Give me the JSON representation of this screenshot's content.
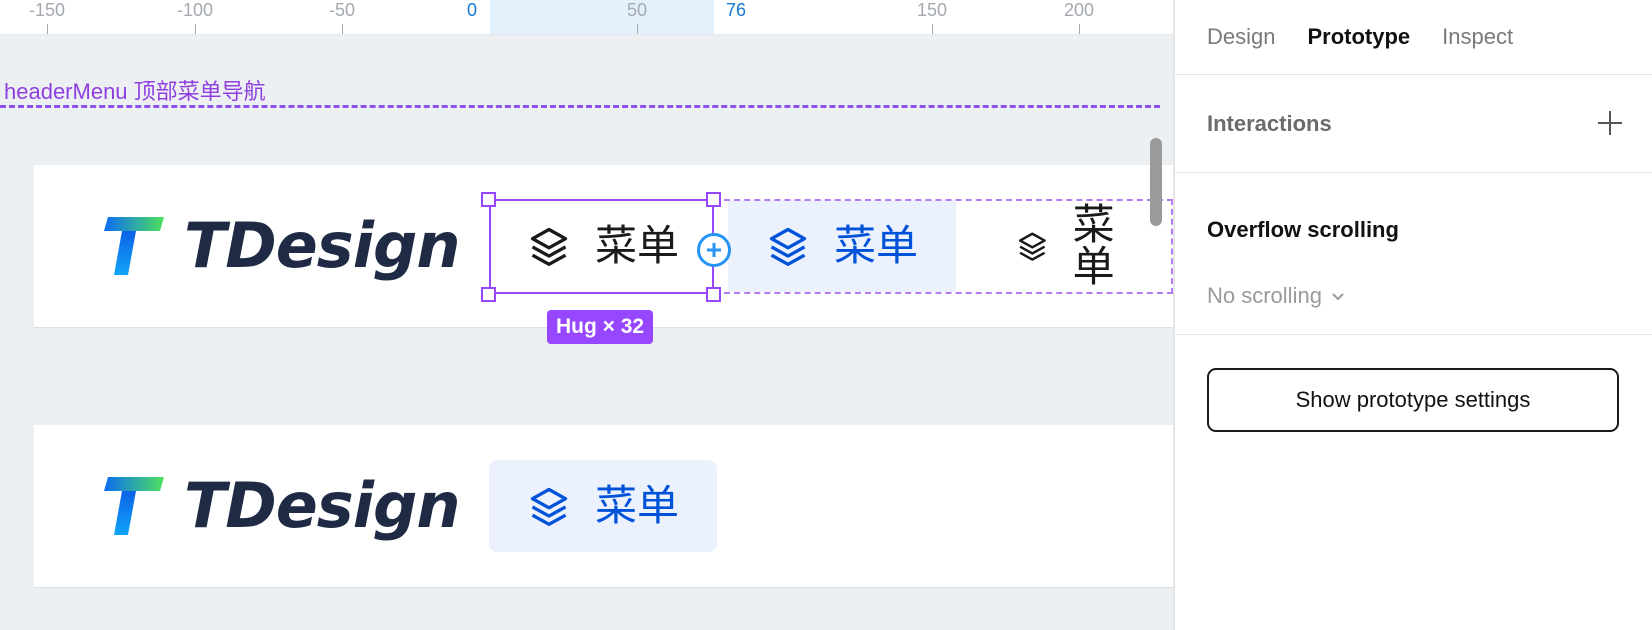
{
  "ruler": {
    "labels": [
      "-150",
      "-100",
      "-50",
      "0",
      "50",
      "76",
      "150",
      "200"
    ]
  },
  "canvas": {
    "frame_label": "headerMenu 顶部菜单导航",
    "hug_badge": "Hug × 32",
    "frame1": {
      "logo_text": "TDesign",
      "menu_items": [
        {
          "label": "菜单",
          "icon": "layers-icon",
          "state": "default"
        },
        {
          "label": "菜单",
          "icon": "layers-icon",
          "state": "active"
        },
        {
          "label": "菜单",
          "icon": "layers-icon",
          "state": "default"
        }
      ]
    },
    "frame2": {
      "logo_text": "TDesign",
      "menu_items": [
        {
          "label": "菜单",
          "icon": "layers-icon",
          "state": "active"
        }
      ]
    }
  },
  "panel": {
    "tabs": [
      "Design",
      "Prototype",
      "Inspect"
    ],
    "active_tab": "Prototype",
    "interactions_title": "Interactions",
    "overflow_title": "Overflow scrolling",
    "overflow_value": "No scrolling",
    "prototype_button": "Show prototype settings"
  },
  "colors": {
    "selection": "#9747ff",
    "menu_active_text": "#0052d9",
    "menu_active_bg": "#ebf2fe",
    "ruler_accent": "#1478d4",
    "logo_text": "#1f2a44"
  }
}
